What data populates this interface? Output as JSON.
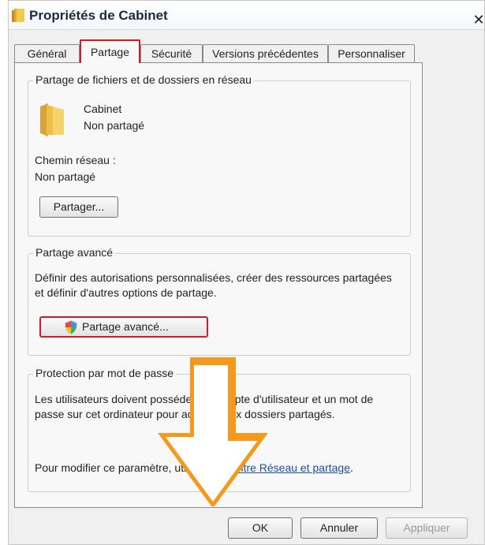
{
  "window": {
    "title": "Propriétés de Cabinet",
    "close_glyph": "✕"
  },
  "tabs": [
    {
      "label": "Général"
    },
    {
      "label": "Partage"
    },
    {
      "label": "Sécurité"
    },
    {
      "label": "Versions précédentes"
    },
    {
      "label": "Personnaliser"
    }
  ],
  "network_sharing": {
    "legend": "Partage de fichiers et de dossiers en réseau",
    "folder_name": "Cabinet",
    "folder_status": "Non partagé",
    "path_label": "Chemin réseau :",
    "path_value": "Non partagé",
    "share_button": "Partager..."
  },
  "advanced_sharing": {
    "legend": "Partage avancé",
    "description": "Définir des autorisations personnalisées, créer des ressources partagées et définir d'autres options de partage.",
    "button": "Partage avancé..."
  },
  "password_protection": {
    "legend": "Protection par mot de passe",
    "description": "Les utilisateurs doivent posséder un compte d'utilisateur et un mot de passe sur cet ordinateur pour accéder aux dossiers partagés.",
    "modify_prefix": "Pour modifier ce paramètre, utilisez le ",
    "link_text": "Centre Réseau et partage",
    "modify_suffix": "."
  },
  "footer": {
    "ok": "OK",
    "cancel": "Annuler",
    "apply": "Appliquer"
  },
  "colors": {
    "highlight": "#d11a2a",
    "arrow": "#f39a1e",
    "link": "#1f4fa0",
    "folder": "#f1c94d"
  }
}
